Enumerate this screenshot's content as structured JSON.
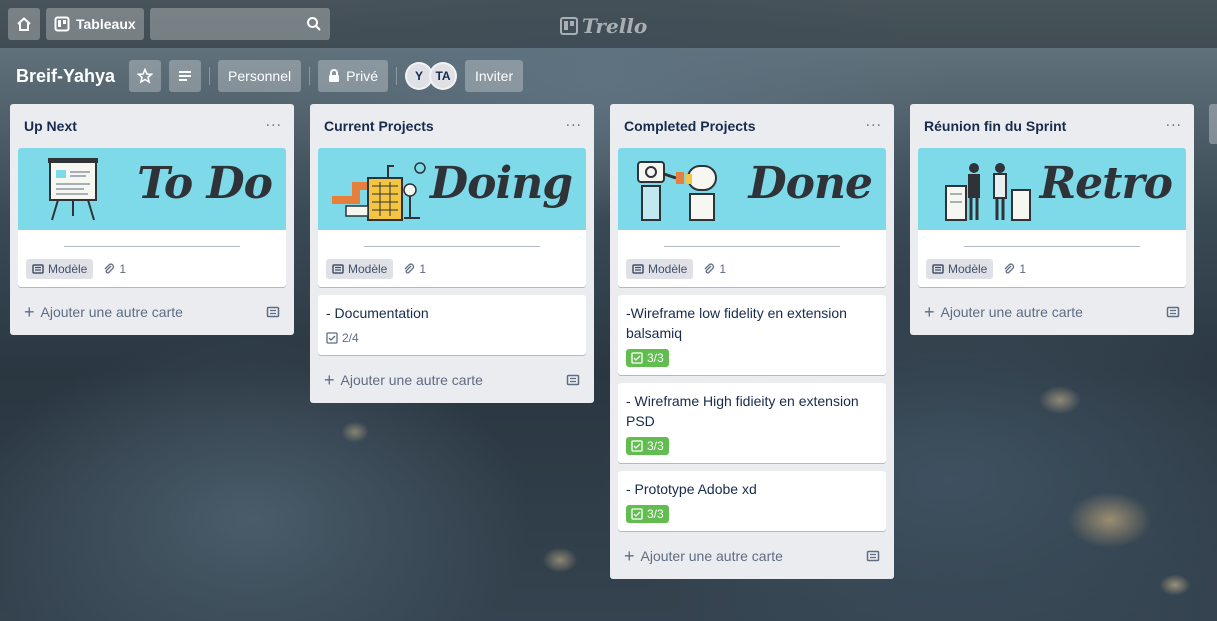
{
  "topbar": {
    "boards_label": "Tableaux",
    "logo_text": "Trello"
  },
  "board": {
    "title": "Breif-Yahya",
    "team_label": "Personnel",
    "visibility_label": "Privé",
    "members": [
      "Y",
      "TA"
    ],
    "invite_label": "Inviter"
  },
  "lists": [
    {
      "title": "Up Next",
      "menu": "···",
      "cover_word": "To Do",
      "template_label": "Modèle",
      "attachments": "1",
      "cards": [],
      "add_label": "Ajouter une autre carte"
    },
    {
      "title": "Current Projects",
      "menu": "···",
      "cover_word": "Doing",
      "template_label": "Modèle",
      "attachments": "1",
      "cards": [
        {
          "text": "- Documentation",
          "checklist": "2/4",
          "complete": false
        }
      ],
      "add_label": "Ajouter une autre carte"
    },
    {
      "title": "Completed Projects",
      "menu": "···",
      "cover_word": "Done",
      "template_label": "Modèle",
      "attachments": "1",
      "cards": [
        {
          "text": "-Wireframe low fidelity en extension balsamiq",
          "checklist": "3/3",
          "complete": true
        },
        {
          "text": "- Wireframe High fidieity en extension PSD",
          "checklist": "3/3",
          "complete": true
        },
        {
          "text": "- Prototype Adobe xd",
          "checklist": "3/3",
          "complete": true
        }
      ],
      "add_label": "Ajouter une autre carte"
    },
    {
      "title": "Réunion fin du Sprint",
      "menu": "···",
      "cover_word": "Retro",
      "template_label": "Modèle",
      "attachments": "1",
      "cards": [],
      "add_label": "Ajouter une autre carte"
    }
  ],
  "colors": {
    "cover": "#7ed9e9",
    "list_bg": "#ebecf0",
    "check_done": "#61bd4f"
  },
  "icons": [
    "home-icon",
    "boards-icon",
    "search-icon",
    "star-icon",
    "menu-icon",
    "lock-icon",
    "template-icon",
    "attachment-icon",
    "checklist-icon",
    "plus-icon"
  ]
}
